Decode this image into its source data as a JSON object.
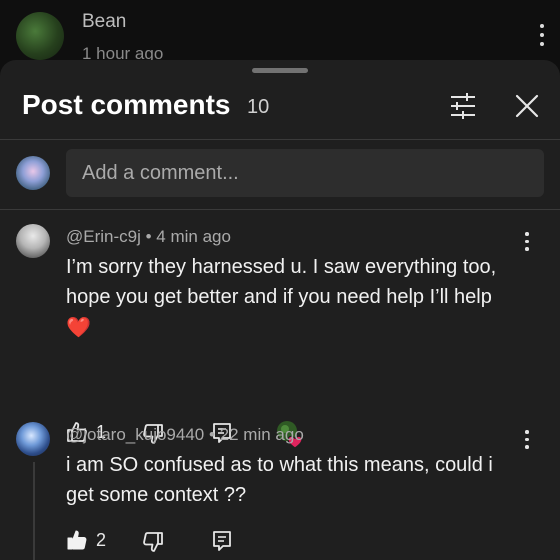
{
  "background_post": {
    "author": "Bean",
    "time": "1 hour ago"
  },
  "sheet": {
    "title": "Post comments",
    "count": "10",
    "filter_icon": "sliders-icon",
    "close_icon": "close-icon"
  },
  "add_comment": {
    "placeholder": "Add a comment..."
  },
  "comments": [
    {
      "author": "@Erin-c9j",
      "time": "4 min ago",
      "text": "I’m sorry they harnessed u. I saw everything too, hope you get better and if you need help I’ll help",
      "emoji": "❤️",
      "likes": "1",
      "liked": false,
      "creator_heart": true
    },
    {
      "author": "@jotaro_kujo9440",
      "time": "22 min ago",
      "text": "i am SO confused as to what this means, could i get some context ??",
      "likes": "2",
      "liked": true
    }
  ],
  "meta_separator": " • ",
  "colors": {
    "sheet_bg": "#1f1f1f",
    "page_bg": "#0f0f0f",
    "heart": "#e0245e"
  }
}
